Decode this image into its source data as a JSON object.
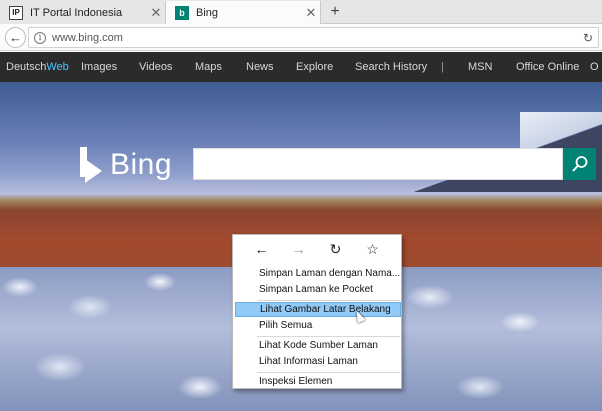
{
  "tabs": [
    {
      "title": "IT Portal Indonesia",
      "favicon": "itportal-icon",
      "active": false
    },
    {
      "title": "Bing",
      "favicon": "bing-icon",
      "active": true
    }
  ],
  "tab_close_glyph": "✕",
  "new_tab_glyph": "+",
  "address": {
    "url": "www.bing.com"
  },
  "bing_nav": {
    "items": [
      {
        "label": "Deutsch",
        "suffix": "Web"
      },
      {
        "label": "Images"
      },
      {
        "label": "Videos"
      },
      {
        "label": "Maps"
      },
      {
        "label": "News"
      },
      {
        "label": "Explore"
      },
      {
        "label": "Search History"
      },
      {
        "label": "|"
      },
      {
        "label": "MSN"
      },
      {
        "label": "Office Online"
      },
      {
        "label": "O"
      }
    ]
  },
  "logo": {
    "text": "Bing"
  },
  "search": {
    "placeholder": "",
    "value": ""
  },
  "context_menu": {
    "items": [
      {
        "label": "Simpan Laman dengan Nama...",
        "highlighted": false
      },
      {
        "label": "Simpan Laman ke Pocket",
        "highlighted": false
      },
      {
        "label": "Lihat Gambar Latar Belakang",
        "highlighted": true
      },
      {
        "label": "Pilih Semua",
        "highlighted": false
      },
      {
        "label": "Lihat Kode Sumber Laman",
        "highlighted": false
      },
      {
        "label": "Lihat Informasi Laman",
        "highlighted": false
      },
      {
        "label": "Inspeksi Elemen",
        "highlighted": false
      }
    ]
  },
  "colors": {
    "bing_teal": "#008373",
    "nav_bg": "#2b2b2b",
    "menu_highlight": "#91c9f7"
  }
}
